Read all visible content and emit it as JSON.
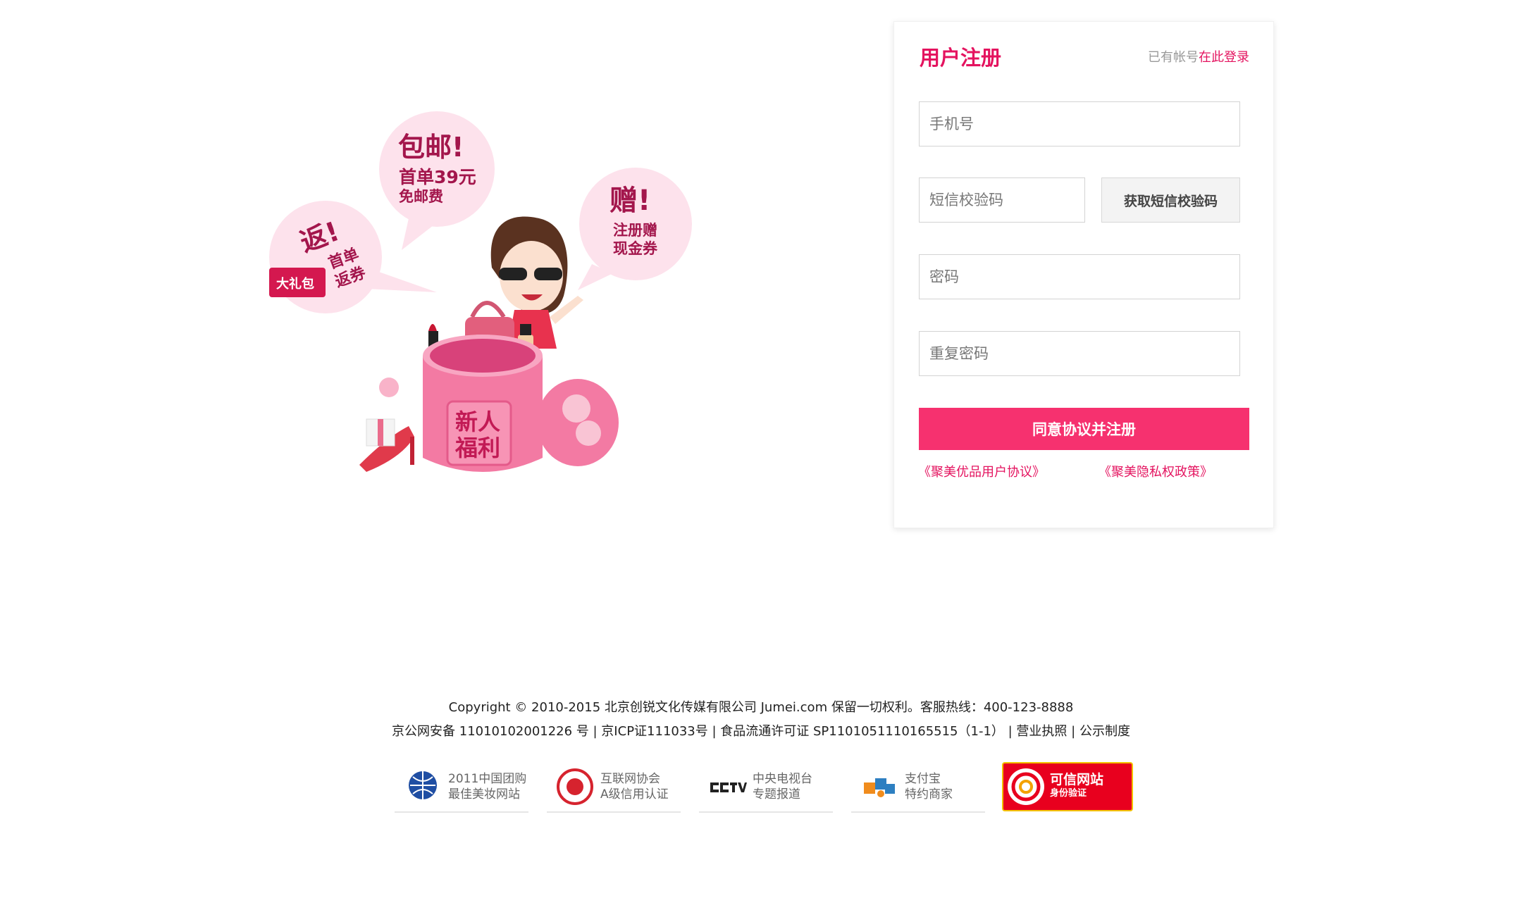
{
  "promo": {
    "bubble_free_shipping_title": "包邮!",
    "bubble_free_shipping_line1": "首单39元",
    "bubble_free_shipping_line2": "免邮费",
    "bubble_gift_title": "赠!",
    "bubble_gift_line1": "注册赠",
    "bubble_gift_line2": "现金券",
    "bubble_return_title": "返!",
    "bubble_return_line1": "首单",
    "bubble_return_line2": "返券",
    "gift_pack_label": "大礼包",
    "box_label_line1": "新人",
    "box_label_line2": "福利"
  },
  "register": {
    "title": "用户注册",
    "login_hint_text": "已有帐号",
    "login_link": "在此登录",
    "phone_placeholder": "手机号",
    "sms_code_placeholder": "短信校验码",
    "get_sms_button": "获取短信校验码",
    "password_placeholder": "密码",
    "repeat_password_placeholder": "重复密码",
    "submit_button": "同意协议并注册",
    "user_agreement_link": "《聚美优品用户协议》",
    "privacy_policy_link": "《聚美隐私权政策》"
  },
  "footer": {
    "copyright": "Copyright © 2010-2015 北京创锐文化传媒有限公司 Jumei.com 保留一切权利。客服热线：400-123-8888",
    "license_text": "京公网安备 11010102001226 号 | 京ICP证111033号 | 食品流通许可证 SP1101051110165515（1-1） |",
    "business_license_link": "营业执照",
    "separator": "|",
    "public_system_link": "公示制度",
    "badges": [
      {
        "line1": "2011中国团购",
        "line2": "最佳美妆网站",
        "icon": "globe-icon"
      },
      {
        "line1": "互联网协会",
        "line2": "A级信用认证",
        "icon": "trust-seal-icon"
      },
      {
        "line1": "中央电视台",
        "line2": "专题报道",
        "icon": "cctv-logo-icon"
      },
      {
        "line1": "支付宝",
        "line2": "特约商家",
        "icon": "puzzle-icon"
      },
      {
        "line1": "可信网站",
        "line2": "身份验证",
        "icon": "trusted-site-icon"
      }
    ]
  },
  "colors": {
    "brand_pink": "#e4135f",
    "button_pink": "#f6316f",
    "bubble_pink": "#fde2ec",
    "badge_red": "#e8001e"
  }
}
